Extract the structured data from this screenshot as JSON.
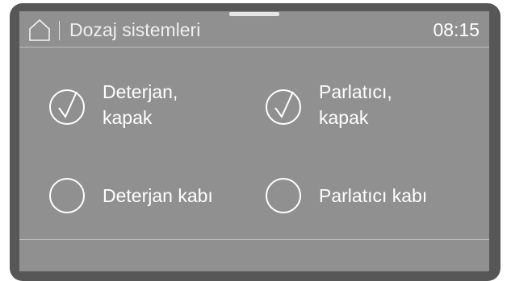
{
  "header": {
    "title": "Dozaj sistemleri",
    "time": "08:15"
  },
  "options": [
    {
      "line1": "Deterjan,",
      "line2": "kapak",
      "checked": true
    },
    {
      "line1": "Parlatıcı,",
      "line2": "kapak",
      "checked": true
    },
    {
      "line1": "Deterjan kabı",
      "line2": "",
      "checked": false
    },
    {
      "line1": "Parlatıcı kabı",
      "line2": "",
      "checked": false
    }
  ],
  "colors": {
    "bezel": "#575757",
    "screen": "#909090",
    "foreground": "#ffffff"
  }
}
